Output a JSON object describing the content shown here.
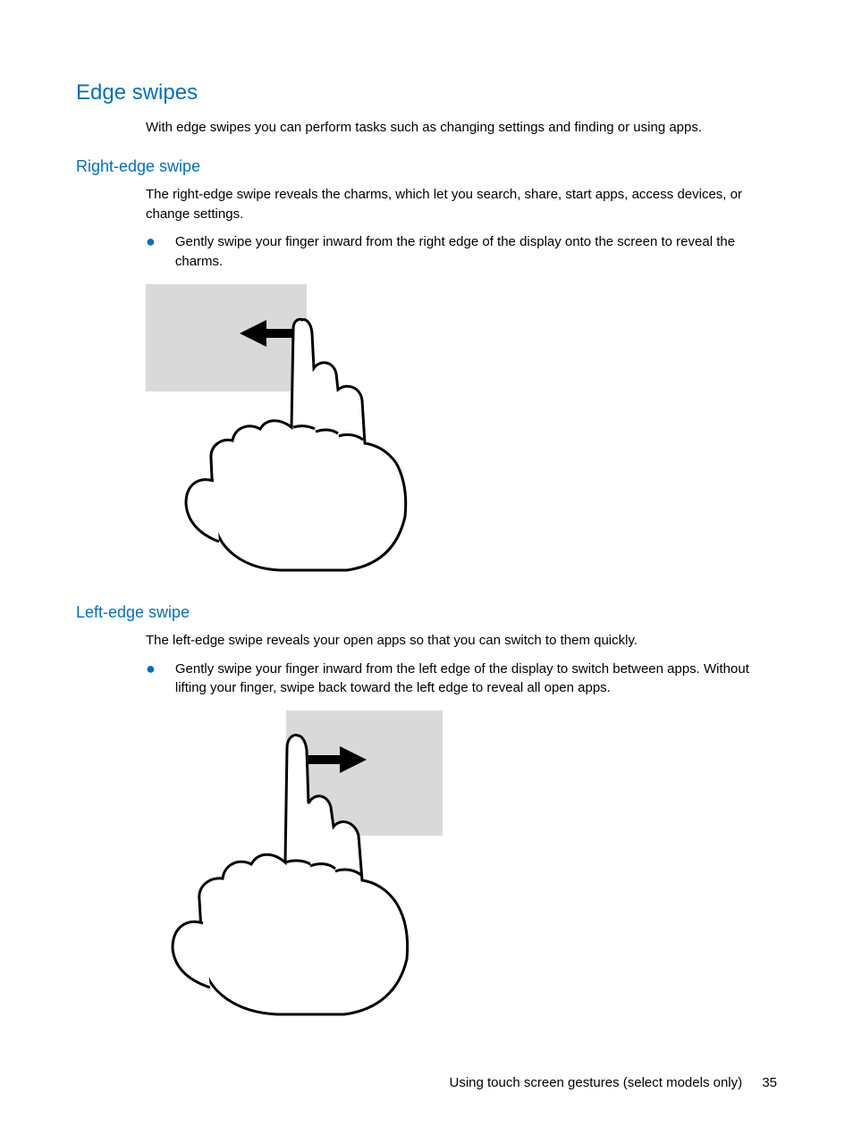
{
  "heading": "Edge swipes",
  "intro": "With edge swipes you can perform tasks such as changing settings and finding or using apps.",
  "sections": [
    {
      "title": "Right-edge swipe",
      "paragraph": "The right-edge swipe reveals the charms, which let you search, share, start apps, access devices, or change settings.",
      "bullet": "Gently swipe your finger inward from the right edge of the display onto the screen to reveal the charms."
    },
    {
      "title": "Left-edge swipe",
      "paragraph": "The left-edge swipe reveals your open apps so that you can switch to them quickly.",
      "bullet": "Gently swipe your finger inward from the left edge of the display to switch between apps. Without lifting your finger, swipe back toward the left edge to reveal all open apps."
    }
  ],
  "footer": {
    "text": "Using touch screen gestures (select models only)",
    "page": "35"
  }
}
